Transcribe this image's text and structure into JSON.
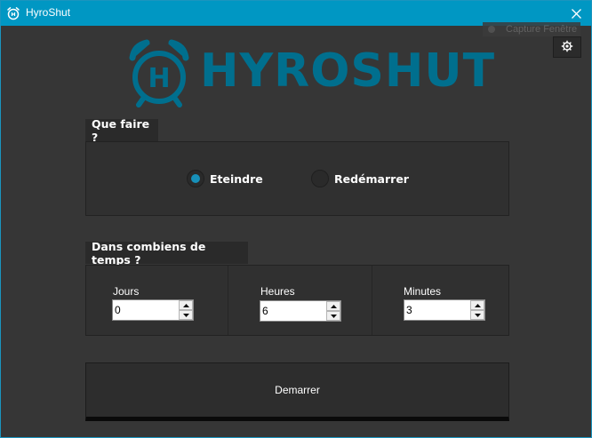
{
  "window": {
    "title": "HyroShut"
  },
  "overlay": {
    "capture_label": "Capture Fenêtre"
  },
  "logo": {
    "text": "HYROSHUT",
    "letter": "H"
  },
  "action_group": {
    "header": "Que faire ?",
    "options": [
      {
        "label": "Eteindre",
        "selected": true
      },
      {
        "label": "Redémarrer",
        "selected": false
      }
    ]
  },
  "time_group": {
    "header": "Dans combiens de temps ?",
    "fields": [
      {
        "label": "Jours",
        "value": "0"
      },
      {
        "label": "Heures",
        "value": "6"
      },
      {
        "label": "Minutes",
        "value": "3"
      }
    ]
  },
  "start_button": {
    "label": "Demarrer"
  },
  "colors": {
    "accent": "#0097c3",
    "logo": "#006f8e",
    "background": "#363636",
    "radio_dot": "#1790b9"
  },
  "icons": {
    "title": "alarm-clock-icon",
    "close": "close-icon",
    "settings": "gear-icon"
  }
}
